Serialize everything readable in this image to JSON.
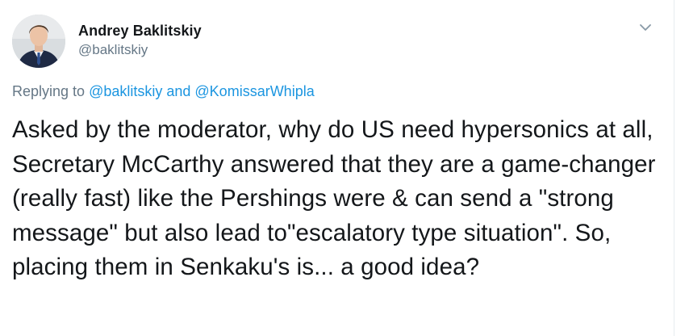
{
  "author": {
    "name": "Andrey Baklitskiy",
    "handle": "@baklitskiy"
  },
  "reply": {
    "prefix": "Replying to ",
    "mention_1": "@baklitskiy",
    "conjunction": " and ",
    "mention_2": "@KomissarWhipla"
  },
  "tweet": {
    "text": "Asked by the moderator, why do US need hypersonics at all, Secretary McCarthy answered that they are a game-changer (really fast) like the Pershings were & can send a \"strong message\" but also lead to\"escalatory type situation\". So, placing them in Senkaku's is... a good idea?"
  },
  "icons": {
    "menu": "chevron-down-icon",
    "avatar": "profile-photo"
  },
  "colors": {
    "text": "#14171a",
    "secondary": "#657786",
    "link": "#1b95e0"
  }
}
